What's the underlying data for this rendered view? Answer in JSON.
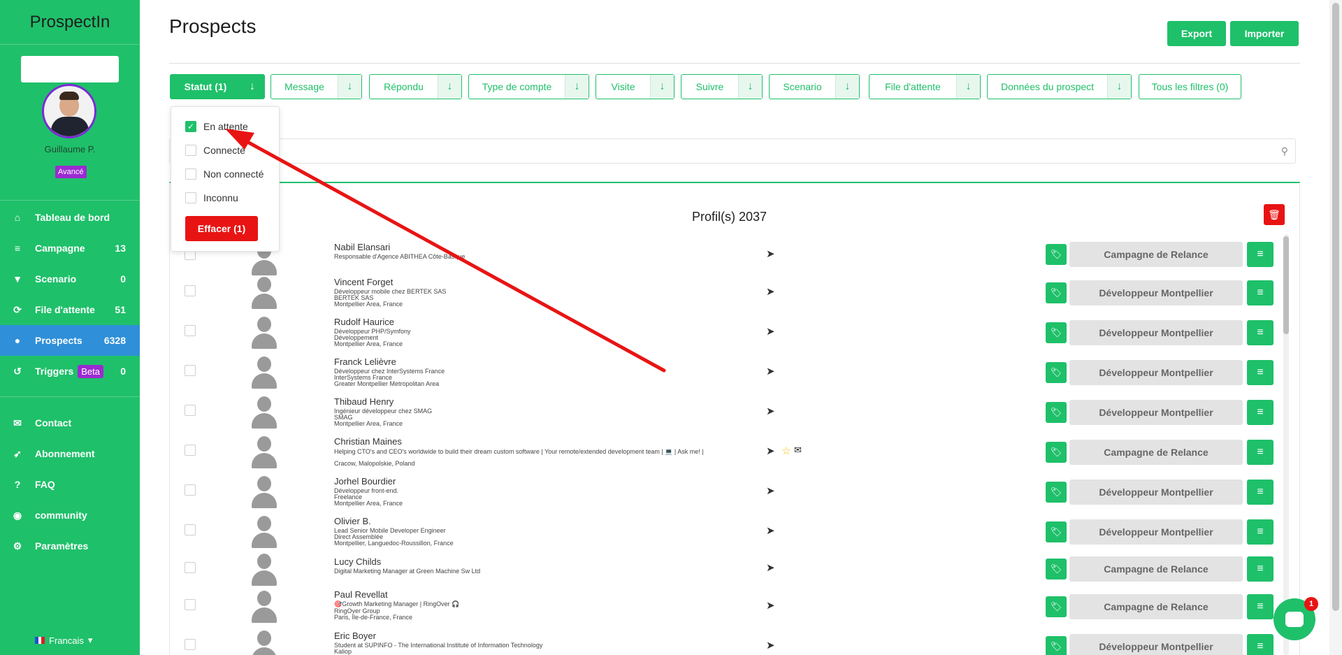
{
  "app": {
    "brand": "ProspectIn"
  },
  "user": {
    "name": "Guillaume P.",
    "plan": "Avancé"
  },
  "sidebar": {
    "items": [
      {
        "label": "Tableau de bord",
        "count": "",
        "icon": "home-icon"
      },
      {
        "label": "Campagne",
        "count": "13",
        "icon": "list-icon"
      },
      {
        "label": "Scenario",
        "count": "0",
        "icon": "filter-icon"
      },
      {
        "label": "File d'attente",
        "count": "51",
        "icon": "sync-icon"
      },
      {
        "label": "Prospects",
        "count": "6328",
        "icon": "user-icon"
      },
      {
        "label": "Triggers",
        "count": "0",
        "badge": "Beta",
        "icon": "history-icon"
      }
    ],
    "secondary": [
      {
        "label": "Contact",
        "icon": "envelope-icon"
      },
      {
        "label": "Abonnement",
        "icon": "rocket-icon"
      },
      {
        "label": "FAQ",
        "icon": "question-icon"
      },
      {
        "label": "community",
        "icon": "discord-icon"
      },
      {
        "label": "Paramètres",
        "icon": "gear-icon"
      }
    ],
    "language": "Francais"
  },
  "header": {
    "title": "Prospects",
    "export_label": "Export",
    "import_label": "Importer"
  },
  "filters": [
    {
      "label": "Statut (1)"
    },
    {
      "label": "Message"
    },
    {
      "label": "Répondu"
    },
    {
      "label": "Type de compte"
    },
    {
      "label": "Visite"
    },
    {
      "label": "Suivre"
    },
    {
      "label": "Scenario"
    },
    {
      "label": "File d'attente"
    },
    {
      "label": "Données du prospect"
    },
    {
      "label": "Tous les filtres (0)"
    }
  ],
  "status_dropdown": {
    "options": [
      {
        "label": "En attente",
        "checked": true
      },
      {
        "label": "Connecté",
        "checked": false
      },
      {
        "label": "Non connecté",
        "checked": false
      },
      {
        "label": "Inconnu",
        "checked": false
      }
    ],
    "clear_label": "Effacer (1)"
  },
  "list": {
    "count_label": "Profil(s) 2037",
    "rows": [
      {
        "name": "Nabil Elansari",
        "lines": [
          "Responsable d'Agence ABITHEA Côte-Basque"
        ],
        "campaign": "Campagne de Relance",
        "icons": [
          "send"
        ]
      },
      {
        "name": "Vincent Forget",
        "lines": [
          "Développeur mobile chez BERTEK SAS",
          "BERTEK SAS",
          "Montpellier Area, France"
        ],
        "campaign": "Développeur Montpellier",
        "icons": [
          "send"
        ]
      },
      {
        "name": "Rudolf Haurice",
        "lines": [
          "Développeur PHP/Symfony",
          "Développement",
          "Montpellier Area, France"
        ],
        "campaign": "Développeur Montpellier",
        "icons": [
          "send"
        ]
      },
      {
        "name": "Franck Lelièvre",
        "lines": [
          "Développeur chez InterSystems France",
          "InterSystems France",
          "Greater Montpellier Metropolitan Area"
        ],
        "campaign": "Développeur Montpellier",
        "icons": [
          "send"
        ]
      },
      {
        "name": "Thibaud Henry",
        "lines": [
          "Ingénieur développeur chez SMAG",
          "SMAG",
          "Montpellier Area, France"
        ],
        "campaign": "Développeur Montpellier",
        "icons": [
          "send"
        ]
      },
      {
        "name": "Christian Maines",
        "lines": [
          "Helping CTO's and CEO's worldwide to build their dream custom software | Your remote/extended development team | 💻 | Ask me! |",
          "",
          "Cracow, Malopolskie, Poland"
        ],
        "campaign": "Campagne de Relance",
        "icons": [
          "send",
          "star",
          "mail"
        ]
      },
      {
        "name": "Jorhel Bourdier",
        "lines": [
          "Développeur front-end.",
          "Freelance",
          "Montpellier Area, France"
        ],
        "campaign": "Développeur Montpellier",
        "icons": [
          "send"
        ]
      },
      {
        "name": "Olivier B.",
        "lines": [
          "Lead Senior Mobile Developer Engineer",
          "Direct Assemblée",
          "Montpellier, Languedoc-Roussillon, France"
        ],
        "campaign": "Développeur Montpellier",
        "icons": [
          "send"
        ]
      },
      {
        "name": "Lucy Childs",
        "lines": [
          "Digital Marketing Manager at Green Machine Sw Ltd"
        ],
        "campaign": "Campagne de Relance",
        "icons": [
          "send"
        ]
      },
      {
        "name": "Paul Revellat",
        "lines": [
          "🎯Growth Marketing Manager | RingOver 🎧",
          "RingOver Group",
          "Paris, Île-de-France, France"
        ],
        "campaign": "Campagne de Relance",
        "icons": [
          "send"
        ]
      },
      {
        "name": "Eric Boyer",
        "lines": [
          "Student at SUPINFO - The International Institute of Information Technology",
          "Kaliop"
        ],
        "campaign": "Développeur Montpellier",
        "icons": [
          "send"
        ]
      }
    ]
  },
  "chat": {
    "badge": "1"
  },
  "colors": {
    "brand_green": "#1fc06a",
    "active_blue": "#2f8fd8",
    "danger_red": "#e81414",
    "badge_purple": "#9b2bd1"
  }
}
